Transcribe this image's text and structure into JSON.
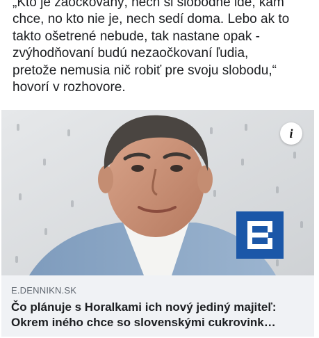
{
  "post": {
    "text_lines": [
      "„Kto je zaočkovaný, nech si slobodne ide, kam",
      "chce, no kto nie je, nech sedí doma. Lebo ak to",
      "takto ošetrené nebude, tak nastane opak -",
      "zvýhodňovaní budú nezaočkovaní ľudia,",
      "pretože nemusia nič robiť pre svoju slobodu,“",
      "hovorí v rozhovore."
    ]
  },
  "link_card": {
    "domain": "E.DENNIKN.SK",
    "title_lines": [
      "Čo plánuje s Horalkami ich nový jediný majiteľ:",
      "Okrem iného chce so slovenskými cukrovink…"
    ],
    "info_icon": "info-icon",
    "logo_icon": "e-dennikn-logo",
    "colors": {
      "logo_blue": "#1b57a8",
      "meta_background": "#f0f2f5",
      "domain_text": "#606770"
    }
  }
}
